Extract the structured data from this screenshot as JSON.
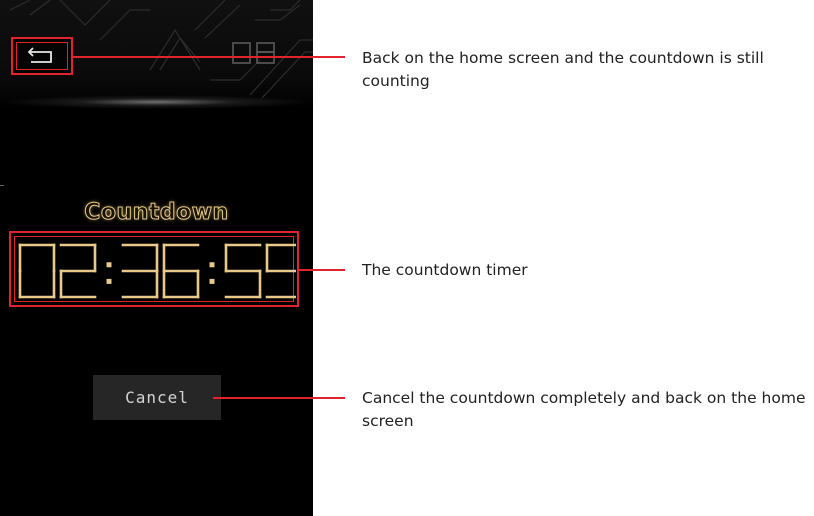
{
  "app": {
    "title": "Countdown",
    "timer": {
      "hours": "02",
      "minutes": "36",
      "seconds": "59",
      "separator": ":"
    },
    "cancel_label": "Cancel",
    "header_digits": "08",
    "back_icon": "back-arrow-icon"
  },
  "callouts": [
    {
      "text": "Back on the home screen and the countdown is still counting"
    },
    {
      "text": "The countdown timer"
    },
    {
      "text": "Cancel the countdown completely and back on the home screen"
    }
  ],
  "colors": {
    "accent": "#e1232b",
    "digit": "#e8c98a",
    "panel": "#000000",
    "button": "#262626"
  }
}
